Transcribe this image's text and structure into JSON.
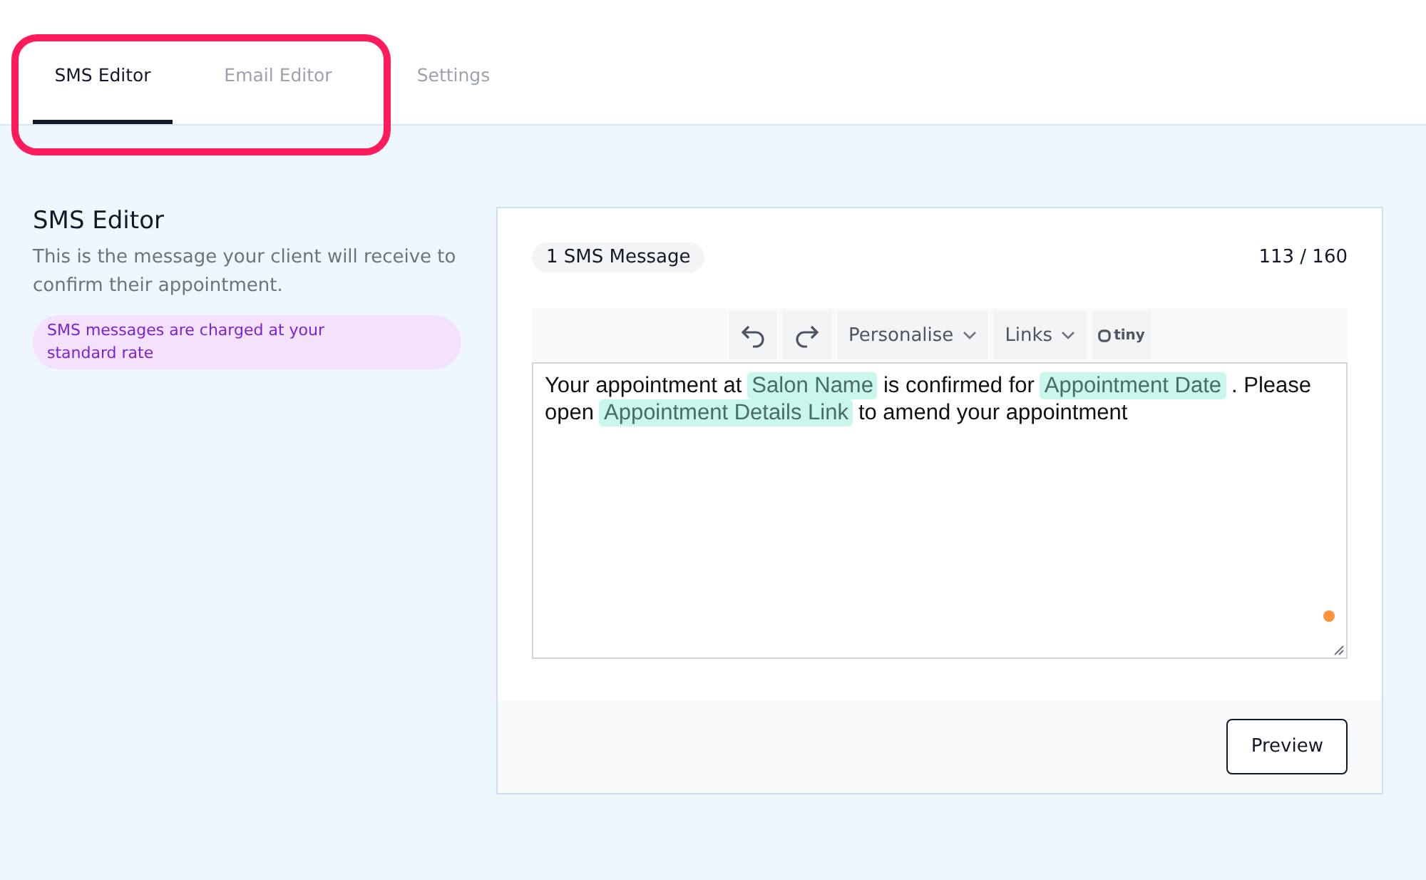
{
  "tabs": [
    {
      "label": "SMS Editor",
      "selected": true
    },
    {
      "label": "Email Editor",
      "selected": false
    },
    {
      "label": "Settings",
      "selected": false
    }
  ],
  "intro": {
    "title": "SMS Editor",
    "description": "This is the message your client will receive to confirm their appointment.",
    "notice": "SMS messages are charged at your standard rate"
  },
  "editor": {
    "message_count": "1 SMS Message",
    "char_count": "113 / 160",
    "toolbar": [
      {
        "kind": "undo"
      },
      {
        "kind": "redo"
      },
      {
        "kind": "menu",
        "label": "Personalise"
      },
      {
        "kind": "menu",
        "label": "Links"
      },
      {
        "kind": "brand",
        "label": "tiny"
      }
    ],
    "content": [
      {
        "kind": "text",
        "text": "Your appointment at"
      },
      {
        "kind": "tag",
        "text": "Salon Name"
      },
      {
        "kind": "text",
        "text": "is confirmed for"
      },
      {
        "kind": "tag",
        "text": "Appointment Date"
      },
      {
        "kind": "text",
        "text": ". Please"
      },
      {
        "kind": "text",
        "text": "open"
      },
      {
        "kind": "tag",
        "text": "Appointment Details Link"
      },
      {
        "kind": "text",
        "text": "to amend your appointment"
      }
    ],
    "button": "Preview"
  }
}
